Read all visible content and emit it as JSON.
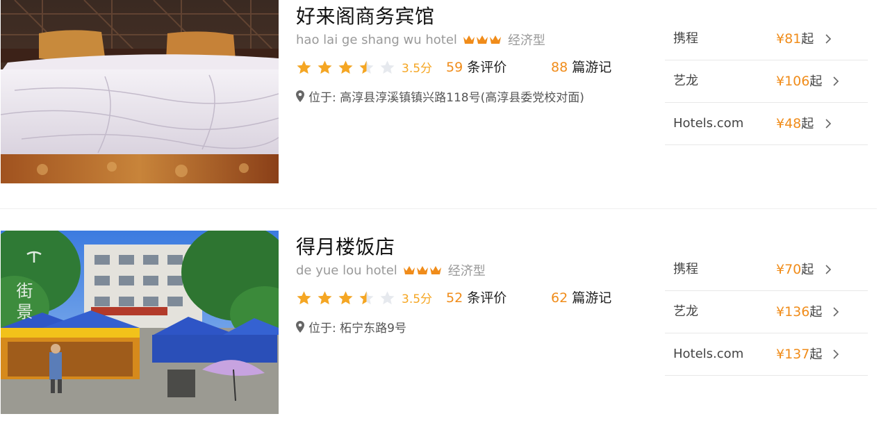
{
  "hotels": [
    {
      "name": "好来阁商务宾馆",
      "english_name": "hao lai ge shang wu hotel",
      "category": "经济型",
      "rating": 3.5,
      "score_text": "3.5分",
      "review_count": "59",
      "review_label": "条评价",
      "note_count": "88",
      "note_label": "篇游记",
      "address": "位于: 高淳县淳溪镇镇兴路118号(高淳县委党校对面)",
      "prices": [
        {
          "ota": "携程",
          "amount": "¥81",
          "suffix": "起"
        },
        {
          "ota": "艺龙",
          "amount": "¥106",
          "suffix": "起"
        },
        {
          "ota": "Hotels.com",
          "amount": "¥48",
          "suffix": "起"
        }
      ]
    },
    {
      "name": "得月楼饭店",
      "english_name": "de yue lou hotel",
      "category": "经济型",
      "rating": 3.5,
      "score_text": "3.5分",
      "review_count": "52",
      "review_label": "条评价",
      "note_count": "62",
      "note_label": "篇游记",
      "address": "位于: 柘宁东路9号",
      "photo_text": "街景",
      "prices": [
        {
          "ota": "携程",
          "amount": "¥70",
          "suffix": "起"
        },
        {
          "ota": "艺龙",
          "amount": "¥136",
          "suffix": "起"
        },
        {
          "ota": "Hotels.com",
          "amount": "¥137",
          "suffix": "起"
        }
      ]
    }
  ],
  "colors": {
    "accent": "#f08c1a",
    "star": "#f5a623",
    "star_empty": "#e6e9ee",
    "crown": "#f08c1a"
  },
  "icons": [
    "crown-icon",
    "star-icon",
    "location-pin-icon",
    "chevron-right-icon"
  ]
}
